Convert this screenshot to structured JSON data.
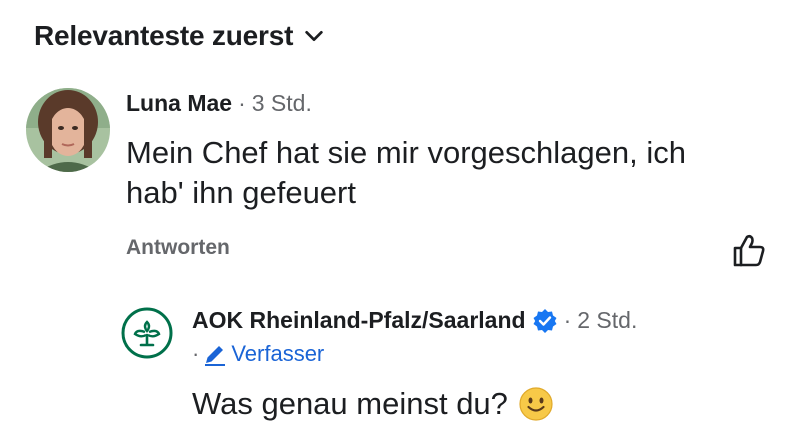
{
  "sort": {
    "label": "Relevanteste zuerst"
  },
  "comment": {
    "author": "Luna Mae",
    "separator": "·",
    "time": "3 Std.",
    "text": "Mein Chef hat sie mir vorgeschlagen, ich hab' ihn gefeuert",
    "reply_label": "Antworten"
  },
  "reply": {
    "author": "AOK Rheinland-Pfalz/Saarland",
    "separator": "·",
    "time": "2 Std.",
    "badge_separator": "·",
    "badge_label": "Verfasser",
    "text": "Was genau meinst du?",
    "emoji": "slightly-smiling-face-icon"
  },
  "icons": {
    "sort": "chevron-down-icon",
    "like": "thumbs-up-outline-icon",
    "verified": "verified-badge-icon",
    "author_badge": "pencil-icon"
  },
  "colors": {
    "text": "#1c1e21",
    "secondary": "#65676b",
    "link_blue": "#1a64d6",
    "verified_blue": "#1877f2",
    "aok_green": "#00704a",
    "emoji_yellow": "#f7c948"
  }
}
